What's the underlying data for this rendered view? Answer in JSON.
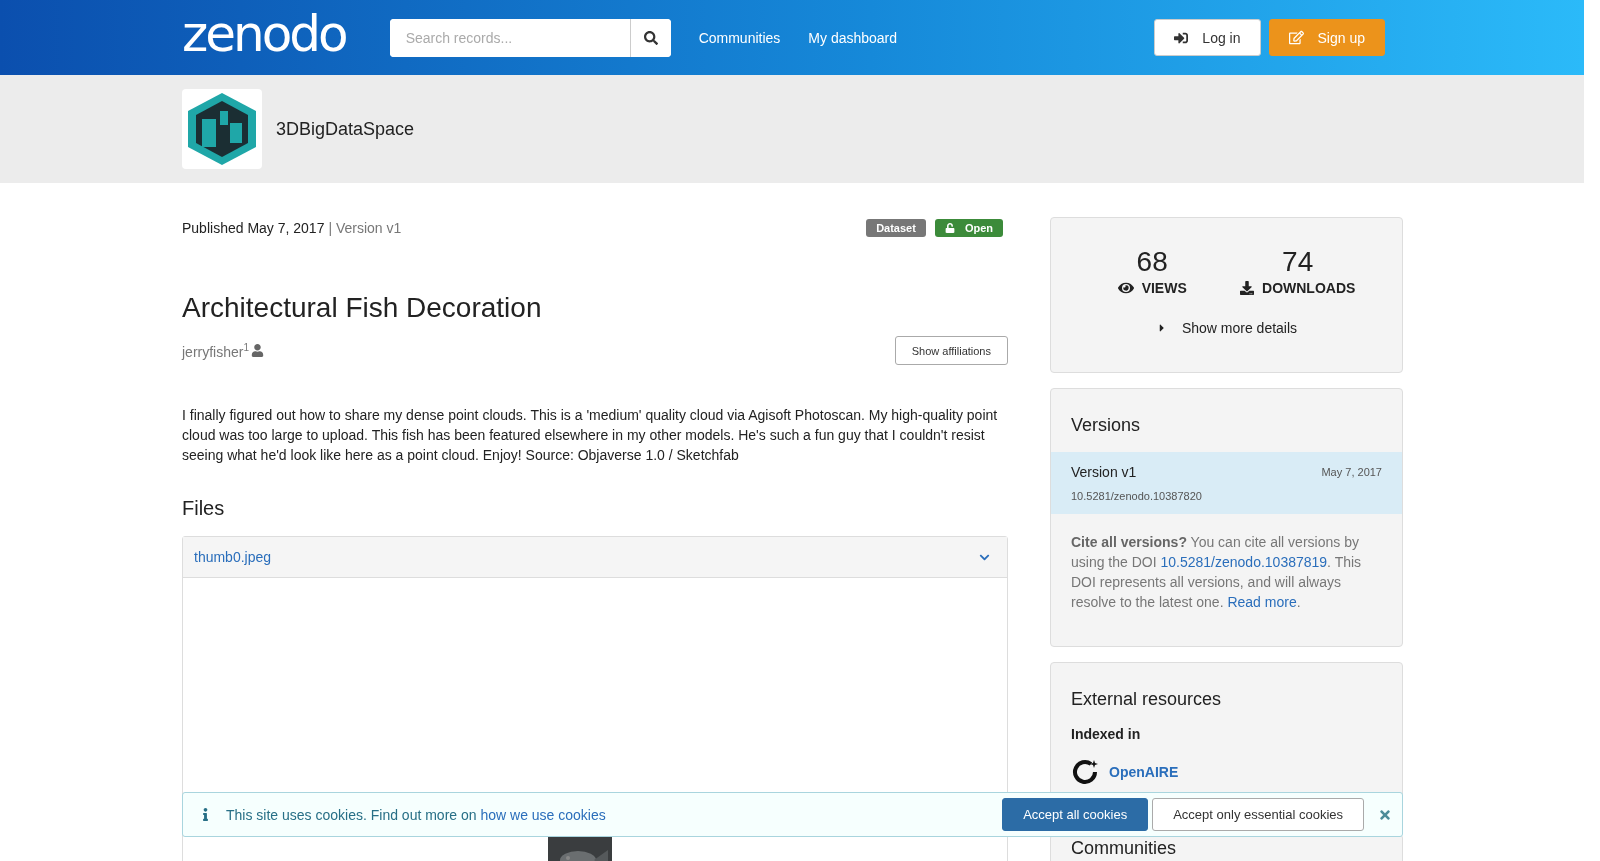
{
  "header": {
    "logo": "zenodo",
    "search": {
      "placeholder": "Search records..."
    },
    "nav": [
      "Communities",
      "My dashboard"
    ],
    "buttons": [
      {
        "label": "Log in",
        "kind": "login"
      },
      {
        "label": "Sign up",
        "kind": "signup"
      }
    ]
  },
  "community": {
    "name": "3DBigDataSpace"
  },
  "record": {
    "published": "Published May 7, 2017",
    "version": "| Version v1",
    "badges": [
      {
        "label": "Dataset",
        "kind": "type"
      },
      {
        "label": "Open",
        "kind": "access"
      }
    ],
    "title": "Architectural Fish Decoration",
    "author": "jerryfisher$^{1}$",
    "affiliations_button": "Show affiliations",
    "description": "I finally figured out how to share my dense point clouds. This is a 'medium' quality cloud via Agisoft Photoscan. My high-quality point cloud was too large to upload. This fish has been featured elsewhere in my other models. He's such a fun guy that I couldn't resist seeing what he'd look like here as a point cloud. Enjoy! Source: Objaverse 1.0 / Sketchfab",
    "files": {
      "title": "Files",
      "items": [
        {
          "name": "thumb0.jpeg",
          "expanded": true
        }
      ]
    }
  },
  "sidebar": {
    "stats": [
      {
        "value": "68",
        "label": "VIEWS",
        "kind": "views"
      },
      {
        "value": "74",
        "label": "DOWNLOADS",
        "kind": "downloads"
      }
    ],
    "more_details": "Show more details",
    "versions": {
      "title": "Versions",
      "items": [
        {
          "label": "Version v1",
          "date": "May 7, 2017",
          "doi": "10.5281/zenodo.10387820",
          "selected": true
        }
      ],
      "cite": {
        "lead": "**Cite all versions?** You can cite all versions by using the DOI",
        "doi_link": "10.5281/zenodo.10387819",
        "middle": ". This DOI represents all versions, and will always resolve to the latest one.",
        "read_more": "Read more",
        "end": "."
      }
    },
    "external": {
      "title": "External resources",
      "subtitle": "Indexed in",
      "link": "OpenAIRE"
    },
    "communities_title": "Communities"
  },
  "cookie_banner": {
    "text": "This site uses cookies. Find out more on",
    "link": "how we use cookies",
    "buttons": [
      {
        "label": "Accept all cookies",
        "kind": "primary"
      },
      {
        "label": "Accept only essential cookies",
        "kind": "secondary"
      }
    ]
  }
}
